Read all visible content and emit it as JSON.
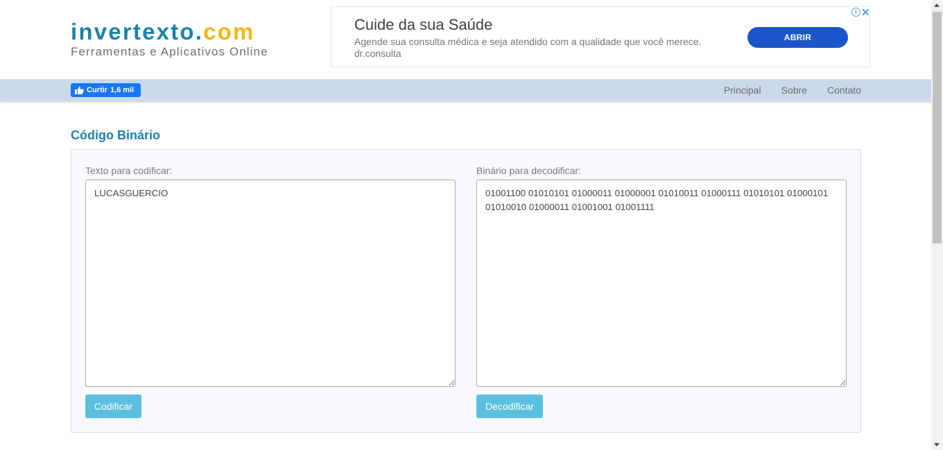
{
  "logo": {
    "name_main": "invertexto",
    "name_dot": ".",
    "name_tld": "com",
    "tagline": "Ferramentas e Aplicativos Online"
  },
  "ad": {
    "title": "Cuide da sua Saúde",
    "description": "Agende sua consulta médica e seja atendido com a qualidade que você merece.",
    "domain": "dr.consulta",
    "button_label": "ABRIR",
    "info_glyph": "i",
    "close_glyph": "✕"
  },
  "navbar": {
    "like_label": "Curtir",
    "like_count": "1,6 mil",
    "links": [
      "Principal",
      "Sobre",
      "Contato"
    ]
  },
  "page": {
    "title": "Código Binário"
  },
  "encode": {
    "label": "Texto para codificar:",
    "value": "LUCASGUERCIO",
    "button_label": "Codificar"
  },
  "decode": {
    "label": "Binário para decodificar:",
    "value": "01001100 01010101 01000011 01000001 01010011 01000111 01010101 01000101 01010010 01000011 01001001 01001111",
    "button_label": "Decodificar"
  },
  "colors": {
    "brand_blue": "#1b82a6",
    "brand_yellow": "#f2b716",
    "navbar_bg": "#cbdaeb",
    "button_bg": "#5bc0de",
    "ad_button": "#1a56c9",
    "facebook_blue": "#1877f2"
  }
}
